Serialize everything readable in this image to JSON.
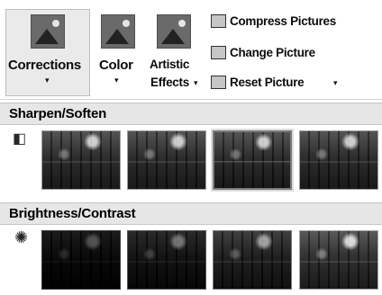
{
  "ribbon": {
    "corrections_label": "Corrections",
    "corrections_arrow": "▾",
    "color_label": "Color",
    "color_arrow": "▾",
    "artistic_label_1": "Artistic",
    "artistic_label_2": "Effects",
    "artistic_arrow": "▾",
    "compress_label": "Compress Pictures",
    "change_label": "Change Picture",
    "reset_label": "Reset Picture",
    "reset_arrow": "▾"
  },
  "sharpen_section": {
    "title": "Sharpen/Soften",
    "icon": "sharpen-icon",
    "thumbnail_count": 4,
    "selected_index": 2
  },
  "brightness_section": {
    "title": "Brightness/Contrast",
    "icon": "brightness-sun-icon",
    "thumbnail_count": 4
  }
}
